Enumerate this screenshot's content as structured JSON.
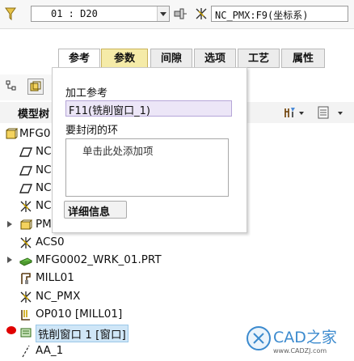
{
  "toolbar": {
    "dropdown1_value": "01 : D20",
    "dropdown2_value": "NC_PMX:F9(坐标系)"
  },
  "tabs": [
    {
      "label": "参考"
    },
    {
      "label": "参数"
    },
    {
      "label": "间隙"
    },
    {
      "label": "选项"
    },
    {
      "label": "工艺"
    },
    {
      "label": "属性"
    }
  ],
  "panel": {
    "ref_label": "加工参考",
    "ref_value": "F11(铣削窗口_1)",
    "loop_label": "要封闭的环",
    "loop_placeholder": "单击此处添加项",
    "details_button": "详细信息"
  },
  "tree": {
    "header": "模型树",
    "items": [
      {
        "label": "MFG0",
        "icon": "assembly-icon"
      },
      {
        "label": "NC",
        "icon": "datum-plane-icon"
      },
      {
        "label": "NC",
        "icon": "datum-plane-icon"
      },
      {
        "label": "NC",
        "icon": "datum-plane-icon"
      },
      {
        "label": "NC",
        "icon": "csys-icon"
      },
      {
        "label": "PM",
        "icon": "part-icon"
      },
      {
        "label": "ACS0",
        "icon": "csys-icon"
      },
      {
        "label": "MFG0002_WRK_01.PRT",
        "icon": "workpiece-icon"
      },
      {
        "label": "MILL01",
        "icon": "mill-workcell-icon"
      },
      {
        "label": "NC_PMX",
        "icon": "csys-icon"
      },
      {
        "label": "OP010 [MILL01]",
        "icon": "operation-icon"
      },
      {
        "label": "铣削窗口 1 [窗口]",
        "icon": "window-mill-icon"
      },
      {
        "label": "AA_1",
        "icon": "axis-icon"
      }
    ]
  },
  "watermark": {
    "brand": "CAD之家",
    "url": "www.CADZJ.com"
  },
  "colors": {
    "accent_tab": "#f5eba8",
    "selected_field": "#ece6f7",
    "highlight_row": "#cfe6f7",
    "red_dot": "#e00000"
  }
}
